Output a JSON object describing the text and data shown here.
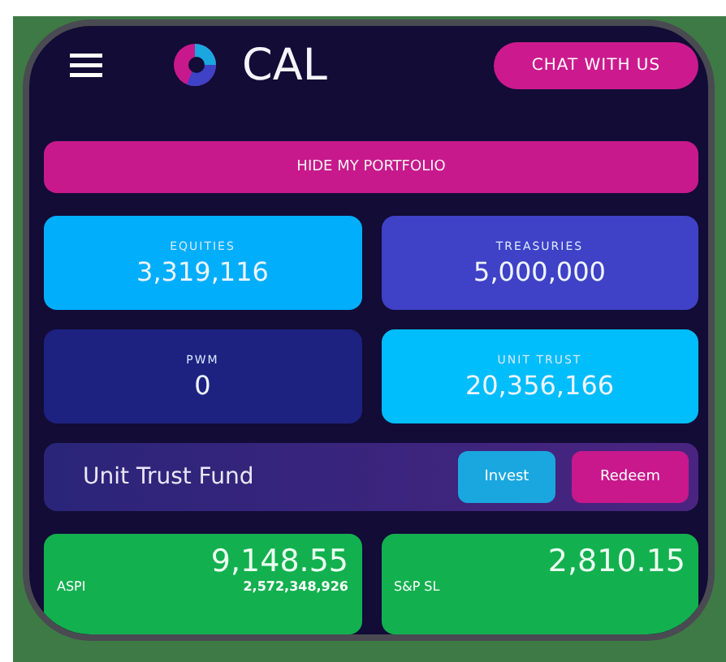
{
  "header": {
    "brand": "CAL",
    "chat_button": "CHAT WITH US"
  },
  "hide_button": "HIDE MY PORTFOLIO",
  "holdings": [
    {
      "label": "EQUITIES",
      "value": "3,319,116",
      "color": "#00aefc"
    },
    {
      "label": "TREASURIES",
      "value": "5,000,000",
      "color": "#3f41c6"
    },
    {
      "label": "PWM",
      "value": "0",
      "color": "#1d2280"
    },
    {
      "label": "UNIT TRUST",
      "value": "20,356,166",
      "color": "#00bdfc"
    }
  ],
  "fund": {
    "title": "Unit Trust Fund",
    "buttons": [
      {
        "label": "Invest",
        "kind": "invest"
      },
      {
        "label": "Redeem",
        "kind": "redeem"
      }
    ]
  },
  "indices": [
    {
      "name": "ASPI",
      "value": "9,148.55",
      "volume": "2,572,348,926"
    },
    {
      "name": "S&P SL",
      "value": "2,810.15"
    }
  ]
}
